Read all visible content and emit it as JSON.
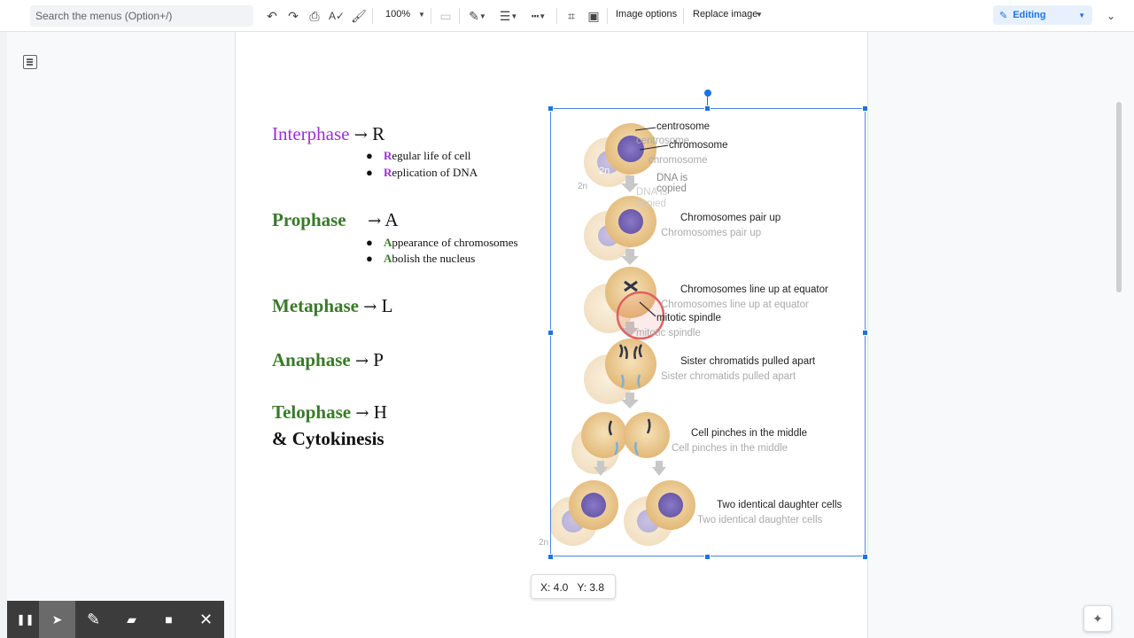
{
  "toolbar": {
    "search_placeholder": "Search the menus (Option+/)",
    "zoom": "100%",
    "image_options": "Image options",
    "replace_image": "Replace image",
    "mode": "Editing"
  },
  "phases": {
    "interphase": {
      "name": "Interphase",
      "arrow": "→",
      "letter": "R"
    },
    "prophase": {
      "name": "Prophase",
      "arrow": "→",
      "letter": "A"
    },
    "metaphase": {
      "name": "Metaphase",
      "arrow": "→",
      "letter": "L"
    },
    "anaphase": {
      "name": "Anaphase",
      "arrow": "→",
      "letter": "P"
    },
    "telophase": {
      "name": "Telophase",
      "arrow": "→",
      "letter": "H"
    },
    "cytokinesis_prefix": "& ",
    "cytokinesis": "Cytokinesis"
  },
  "bullets": {
    "interphase": [
      {
        "first": "R",
        "rest": "egular life of cell"
      },
      {
        "first": "R",
        "rest": "eplication of DNA"
      }
    ],
    "prophase": [
      {
        "first": "A",
        "rest": "ppearance of chromosomes"
      },
      {
        "first": "A",
        "rest": "bolish the nucleus"
      }
    ]
  },
  "diagram": {
    "centrosome": "centrosome",
    "chromosome": "chromosome",
    "dna_copied_1": "DNA is",
    "dna_copied_2": "copied",
    "pair_up": "Chromosomes pair up",
    "line_up": "Chromosomes line up at equator",
    "spindle": "mitotic spindle",
    "pulled": "Sister chromatids pulled apart",
    "pinches": "Cell pinches in the middle",
    "daughters": "Two identical daughter cells",
    "ploidy_top": "2n",
    "ploidy_bottom": "2n"
  },
  "coords": {
    "x": "X: 4.0",
    "y": "Y: 3.8"
  },
  "recorder": {
    "pause": "❚❚",
    "pointer": "➤",
    "pen": "✎",
    "highlighter": "▰",
    "camera": "■",
    "close": "✕"
  },
  "colors": {
    "accent": "#1a73e8",
    "purple": "#9b2fd6",
    "green": "#3a7a2a"
  }
}
